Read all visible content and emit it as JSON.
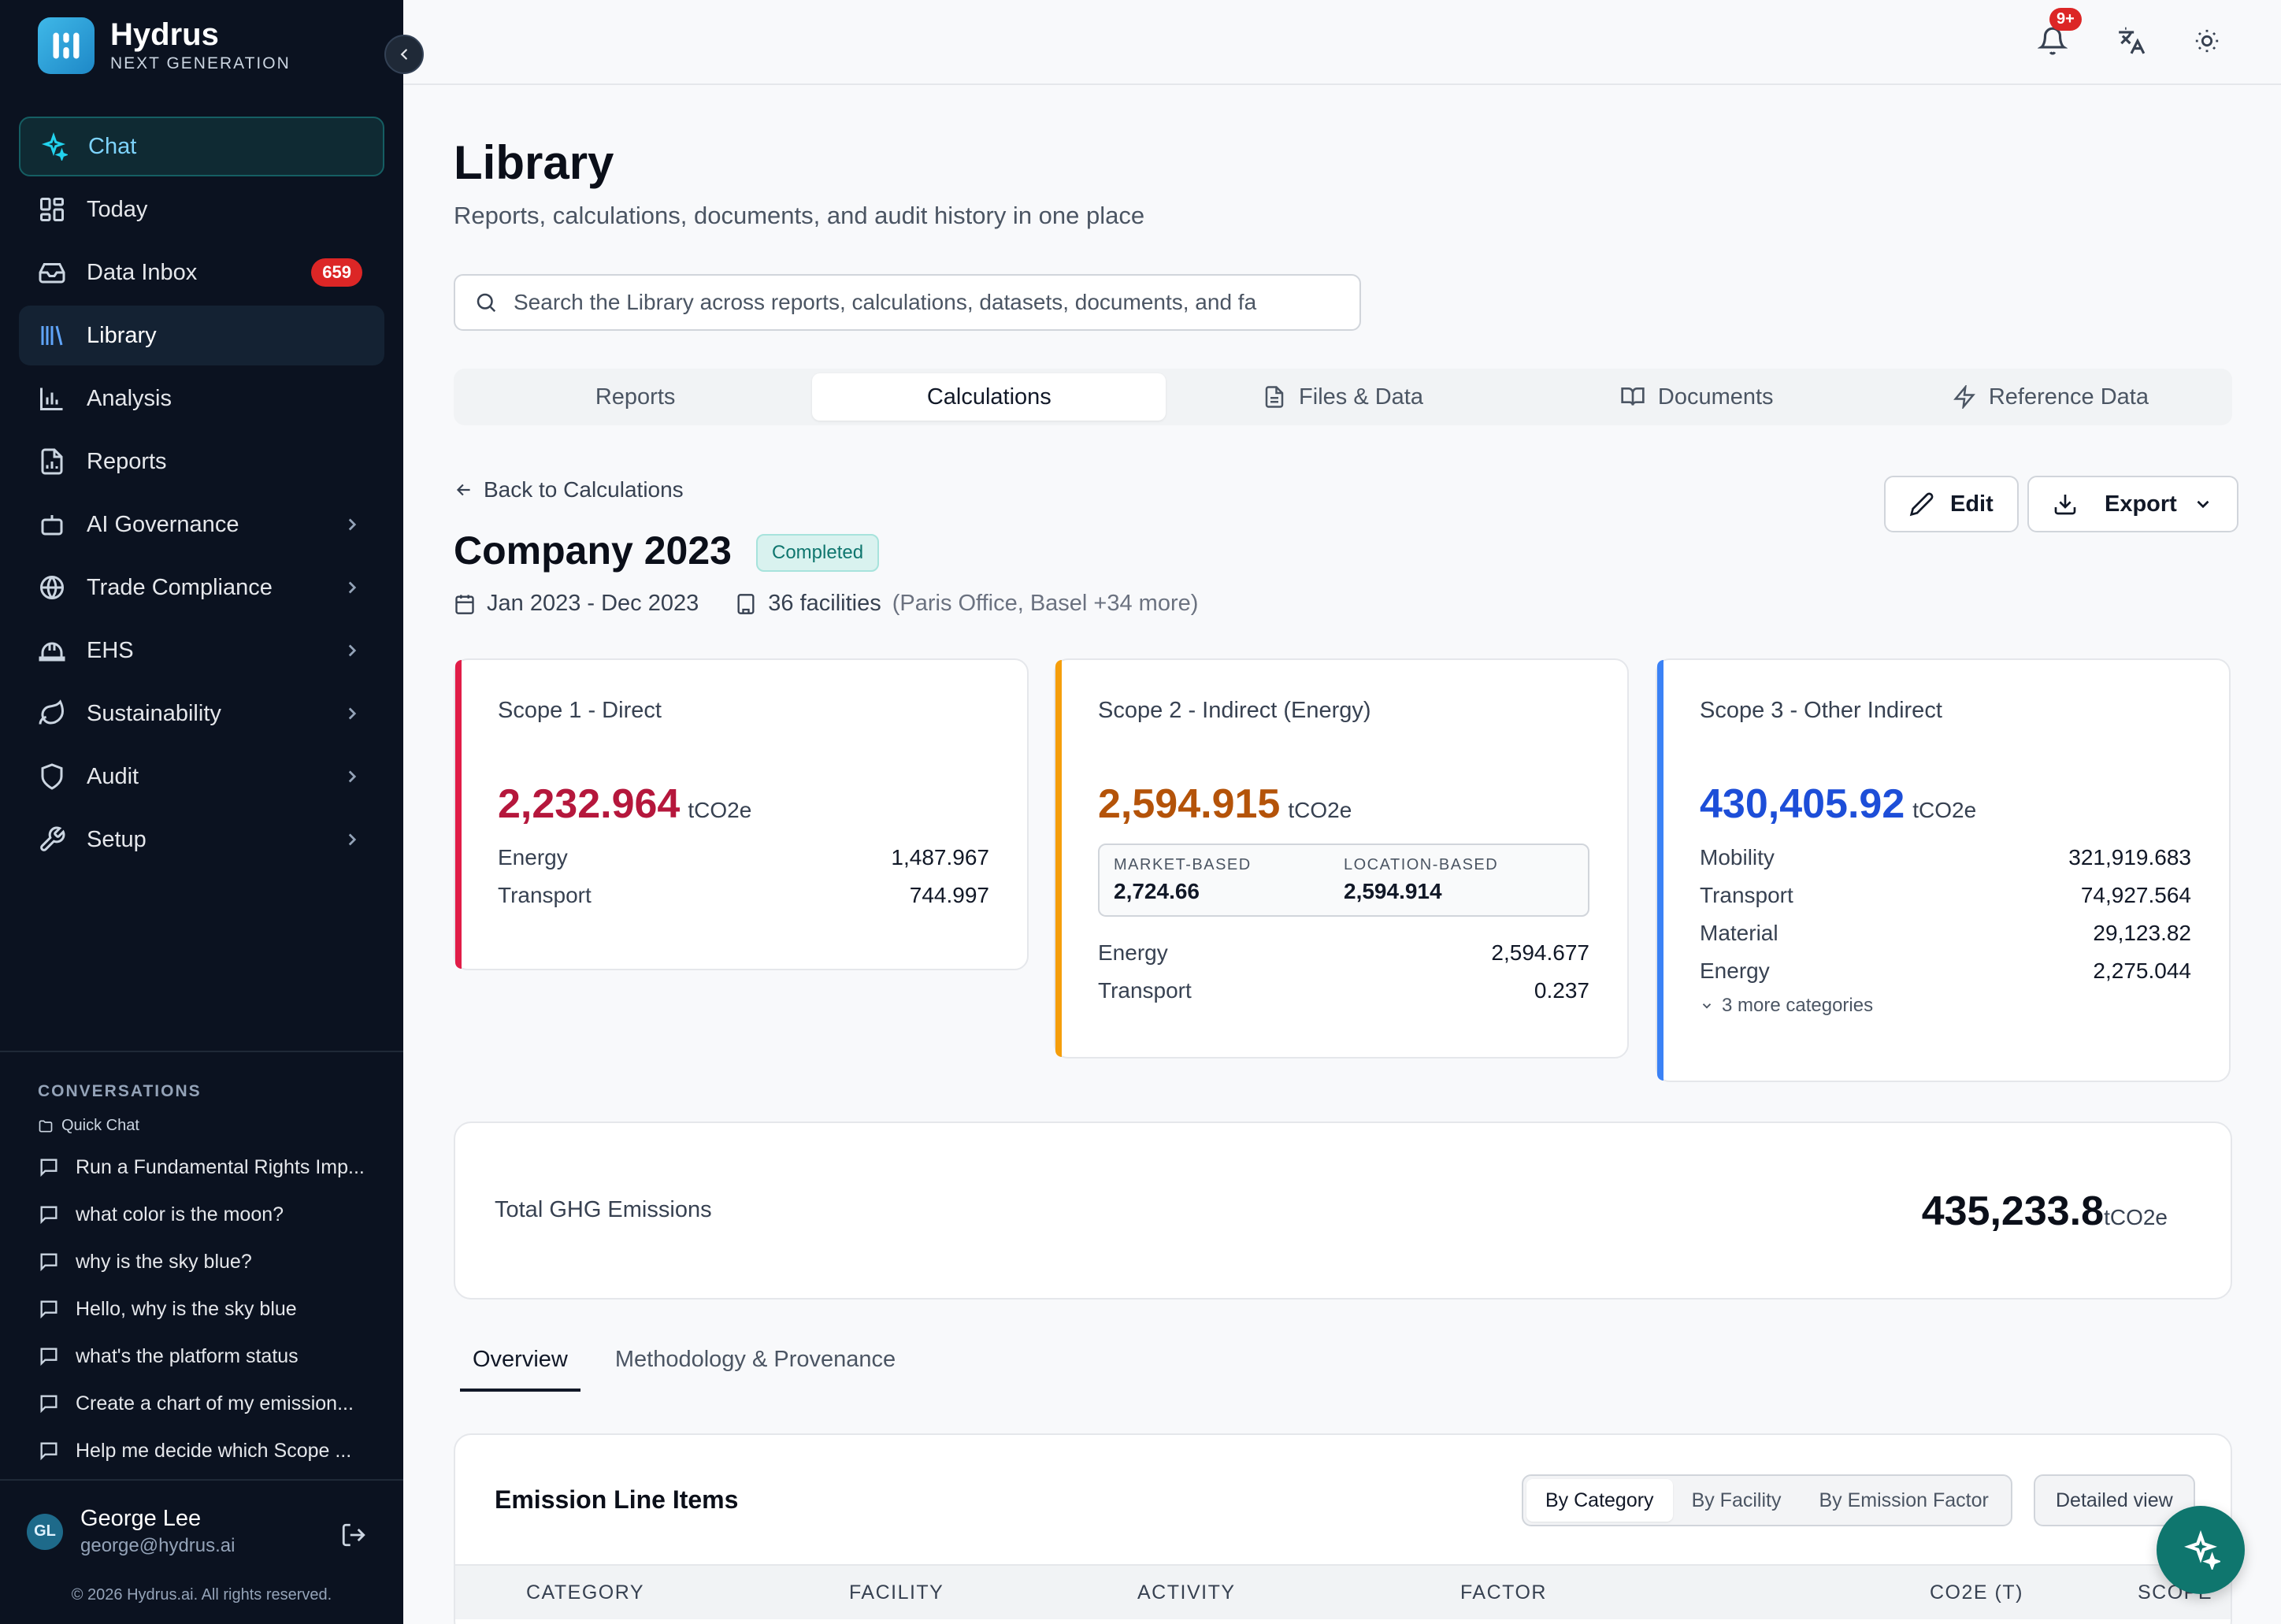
{
  "brand": {
    "name": "Hydrus",
    "tagline": "NEXT GENERATION",
    "accent": "#2fa9dd"
  },
  "sidebar": {
    "items": [
      {
        "label": "Chat",
        "icon": "sparkles-icon"
      },
      {
        "label": "Today",
        "icon": "grid-icon"
      },
      {
        "label": "Data Inbox",
        "icon": "inbox-icon",
        "badge": "659"
      },
      {
        "label": "Library",
        "icon": "library-icon"
      },
      {
        "label": "Analysis",
        "icon": "bar-chart-icon"
      },
      {
        "label": "Reports",
        "icon": "report-icon"
      },
      {
        "label": "AI Governance",
        "icon": "bot-icon"
      },
      {
        "label": "Trade Compliance",
        "icon": "globe-icon"
      },
      {
        "label": "EHS",
        "icon": "hard-hat-icon"
      },
      {
        "label": "Sustainability",
        "icon": "leaf-icon"
      },
      {
        "label": "Audit",
        "icon": "shield-icon"
      },
      {
        "label": "Setup",
        "icon": "wrench-icon"
      }
    ],
    "conversations_title": "CONVERSATIONS",
    "folder": "Quick Chat",
    "conversations": [
      "Run a Fundamental Rights Imp...",
      "what color is the moon?",
      "why is the sky blue?",
      "Hello, why is the sky blue",
      "what's the platform status",
      "Create a chart of my emission...",
      "Help me decide which Scope ..."
    ],
    "user": {
      "initials": "GL",
      "name": "George Lee",
      "email": "george@hydrus.ai"
    },
    "copyright": "© 2026 Hydrus.ai. All rights reserved."
  },
  "topbar": {
    "notification_count": "9+"
  },
  "page": {
    "title": "Library",
    "subtitle": "Reports, calculations, documents, and audit history in one place",
    "search_placeholder": "Search the Library across reports, calculations, datasets, documents, and fa",
    "tabs": [
      "Reports",
      "Calculations",
      "Files & Data",
      "Documents",
      "Reference Data"
    ],
    "active_tab": "Calculations"
  },
  "calc": {
    "back": "Back to Calculations",
    "edit": "Edit",
    "export": "Export",
    "title": "Company 2023",
    "status": "Completed",
    "period": "Jan 2023 - Dec 2023",
    "facilities": "36 facilities",
    "facilities_detail": "(Paris Office, Basel +34 more)",
    "unit": "tCO2e",
    "scope1": {
      "title": "Scope 1 - Direct",
      "value": "2,232.964",
      "color": "#b5173c",
      "accent": "#e11d48",
      "rows": [
        {
          "label": "Energy",
          "value": "1,487.967"
        },
        {
          "label": "Transport",
          "value": "744.997"
        }
      ]
    },
    "scope2": {
      "title": "Scope 2 - Indirect (Energy)",
      "value": "2,594.915",
      "color": "#b45309",
      "accent": "#f59e0b",
      "market_label": "MARKET-BASED",
      "market_value": "2,724.66",
      "location_label": "LOCATION-BASED",
      "location_value": "2,594.914",
      "rows": [
        {
          "label": "Energy",
          "value": "2,594.677"
        },
        {
          "label": "Transport",
          "value": "0.237"
        }
      ]
    },
    "scope3": {
      "title": "Scope 3 - Other Indirect",
      "value": "430,405.92",
      "color": "#1d4ed8",
      "accent": "#3b82f6",
      "rows": [
        {
          "label": "Mobility",
          "value": "321,919.683"
        },
        {
          "label": "Transport",
          "value": "74,927.564"
        },
        {
          "label": "Material",
          "value": "29,123.82"
        },
        {
          "label": "Energy",
          "value": "2,275.044"
        }
      ],
      "more": "3 more categories"
    },
    "total_label": "Total GHG Emissions",
    "total_value": "435,233.8",
    "sub_tabs": [
      "Overview",
      "Methodology & Provenance"
    ],
    "items_title": "Emission Line Items",
    "group_by": [
      "By Category",
      "By Facility",
      "By Emission Factor"
    ],
    "detailed_view": "Detailed view",
    "columns": [
      "CATEGORY",
      "FACILITY",
      "ACTIVITY",
      "FACTOR",
      "CO2E (T)",
      "SCOPE"
    ]
  }
}
